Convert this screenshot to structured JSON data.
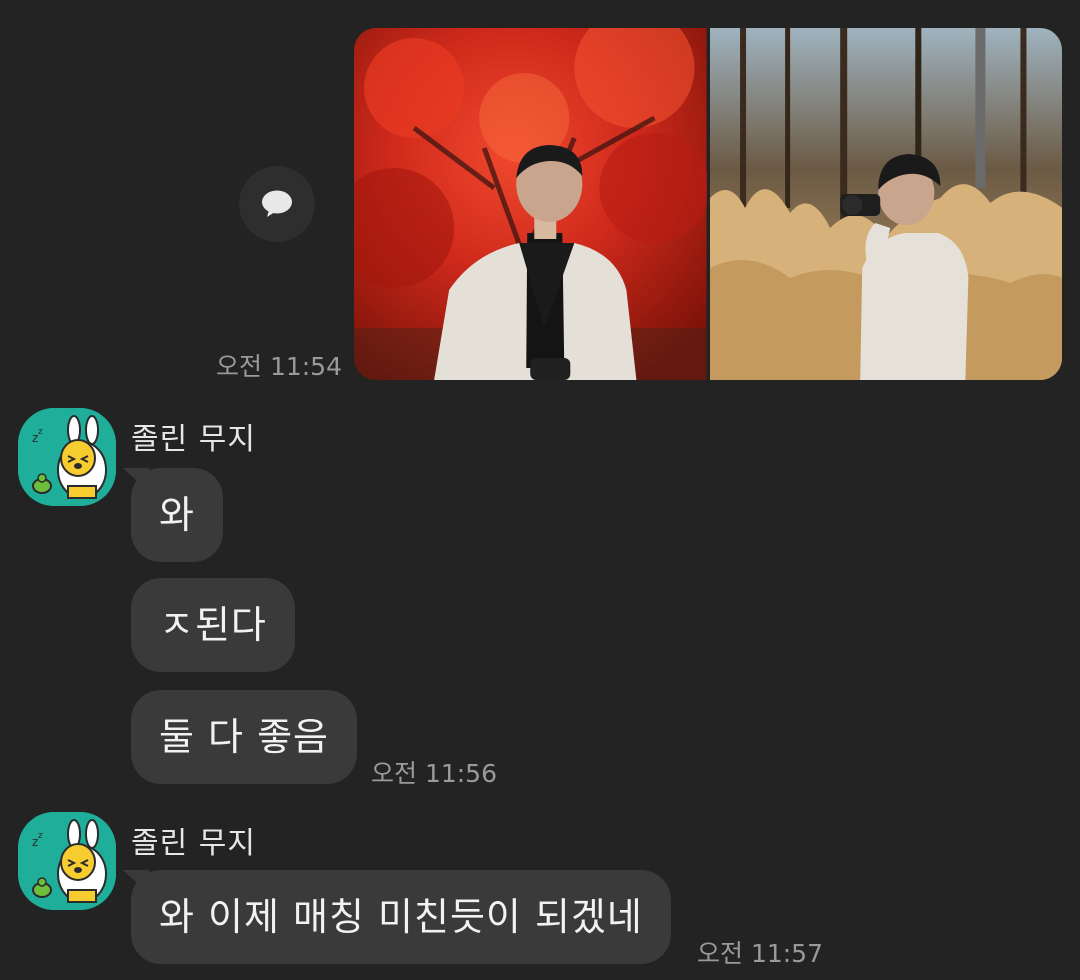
{
  "outgoing": {
    "photo_time": "오전 11:54",
    "share_icon": "chat-bubble-icon",
    "photos": [
      {
        "name": "photo-red-maple",
        "bg": "#c2271c"
      },
      {
        "name": "photo-pampas-grass",
        "bg": "#b89257"
      }
    ]
  },
  "groups": [
    {
      "sender": "졸린 무지",
      "avatar_icon": "muzi-sleepy-avatar",
      "messages": [
        "와",
        "ㅈ된다",
        "둘 다 좋음"
      ],
      "time": "오전 11:56"
    },
    {
      "sender": "졸린 무지",
      "avatar_icon": "muzi-sleepy-avatar",
      "messages": [
        "와 이제 매칭 미친듯이 되겠네"
      ],
      "time": "오전 11:57"
    }
  ],
  "colors": {
    "background": "#232323",
    "bubble": "#3a3a3a",
    "avatar_bg": "#1fae9a",
    "timestamp": "#9a9a9a"
  }
}
